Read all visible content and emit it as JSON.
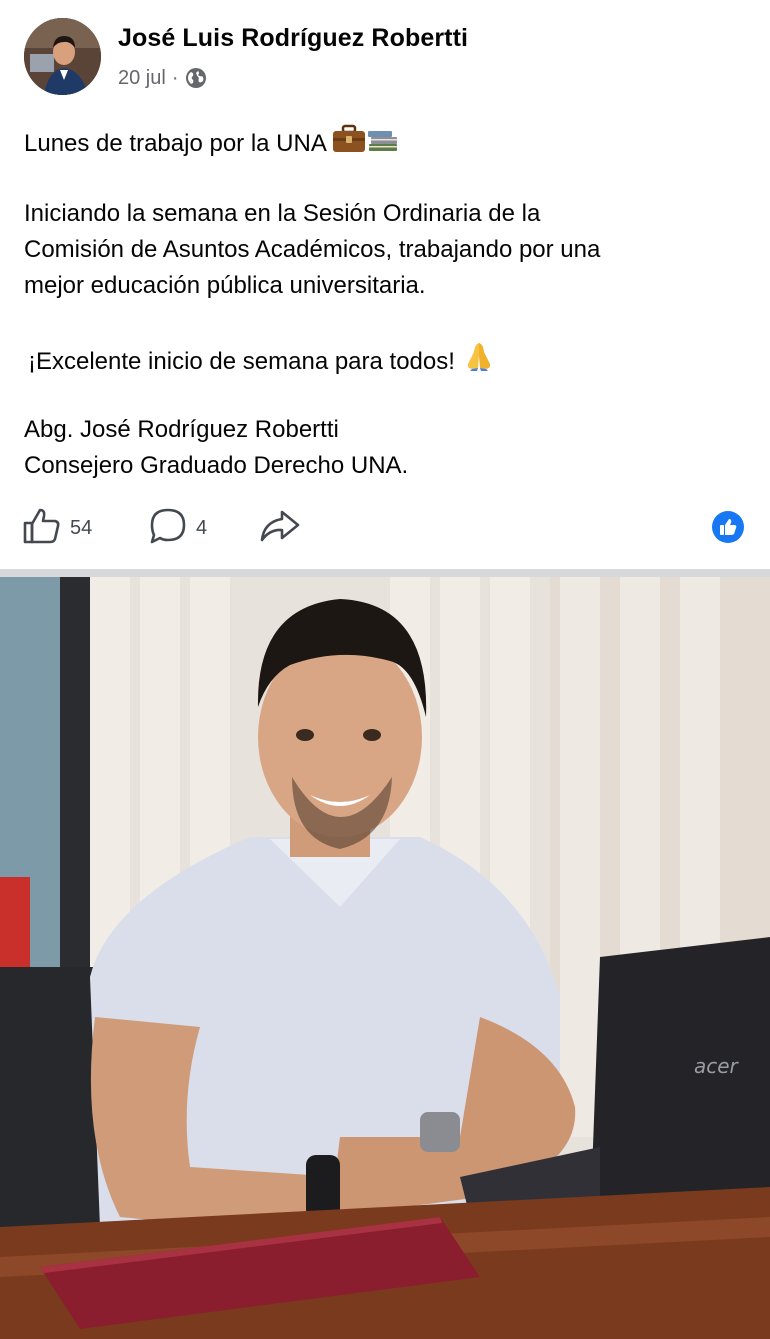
{
  "post": {
    "author": "José Luis Rodríguez Robertti",
    "date": "20 jul",
    "separator": "·",
    "privacy_icon": "globe-icon",
    "text": {
      "line1": "Lunes de trabajo por la UNA",
      "line1_emojis": "briefcase, books",
      "p2_l1": "Iniciando la semana en la Sesión Ordinaria de la",
      "p2_l2": "Comisión de Asuntos Académicos, trabajando por una",
      "p2_l3": "mejor educación pública universitaria.",
      "p3": "¡Excelente inicio de semana para todos!",
      "p3_emoji": "folded-hands",
      "sig1": "Abg. José Rodríguez Robertti",
      "sig2": "Consejero Graduado Derecho UNA."
    },
    "actions": {
      "likes": "54",
      "comments": "4"
    },
    "photo": {
      "laptop_brand": "acer"
    },
    "colors": {
      "accent": "#1877f2",
      "secondary_text": "#65676b",
      "divider": "#d6d8dc"
    }
  }
}
